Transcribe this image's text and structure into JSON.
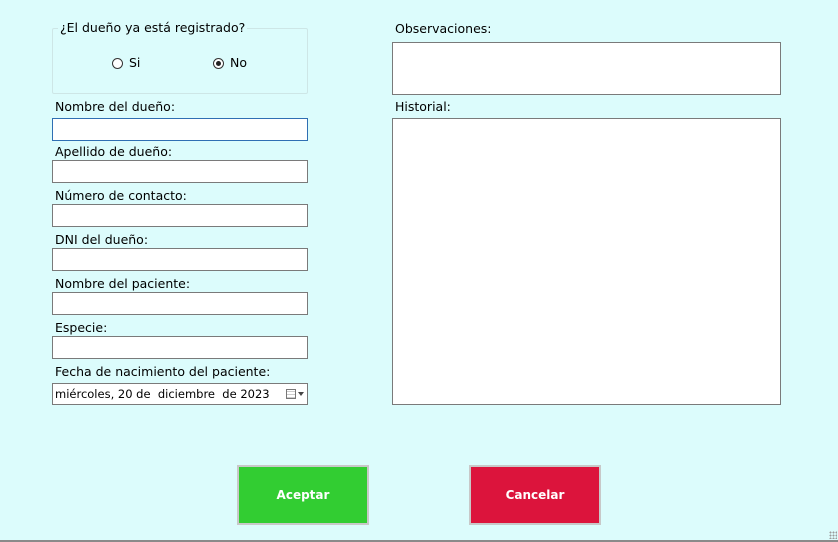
{
  "owner_registered": {
    "legend": "¿El dueño ya está registrado?",
    "options": [
      {
        "label": "Si",
        "checked": false
      },
      {
        "label": "No",
        "checked": true
      }
    ]
  },
  "form": {
    "owner_name": {
      "label": "Nombre del dueño:",
      "value": ""
    },
    "owner_surname": {
      "label": "Apellido de dueño:",
      "value": ""
    },
    "contact_number": {
      "label": "Número de contacto:",
      "value": ""
    },
    "owner_dni": {
      "label": "DNI del dueño:",
      "value": ""
    },
    "patient_name": {
      "label": "Nombre del paciente:",
      "value": ""
    },
    "species": {
      "label": "Especie:",
      "value": ""
    },
    "birth_date": {
      "label": "Fecha de nacimiento del paciente:",
      "value": "miércoles, 20 de  diciembre  de 2023"
    }
  },
  "observations": {
    "label": "Observaciones:",
    "value": ""
  },
  "history": {
    "label": "Historial:",
    "value": ""
  },
  "buttons": {
    "accept": {
      "label": "Aceptar",
      "color": "#32cd32"
    },
    "cancel": {
      "label": "Cancelar",
      "color": "#dc143c"
    }
  },
  "icons": {
    "calendar": "calendar-icon",
    "dropdown": "chevron-down-icon",
    "resize": "resize-grip-icon"
  },
  "colors": {
    "background": "#dcfcfc",
    "focus_border": "#2f6fb3"
  }
}
